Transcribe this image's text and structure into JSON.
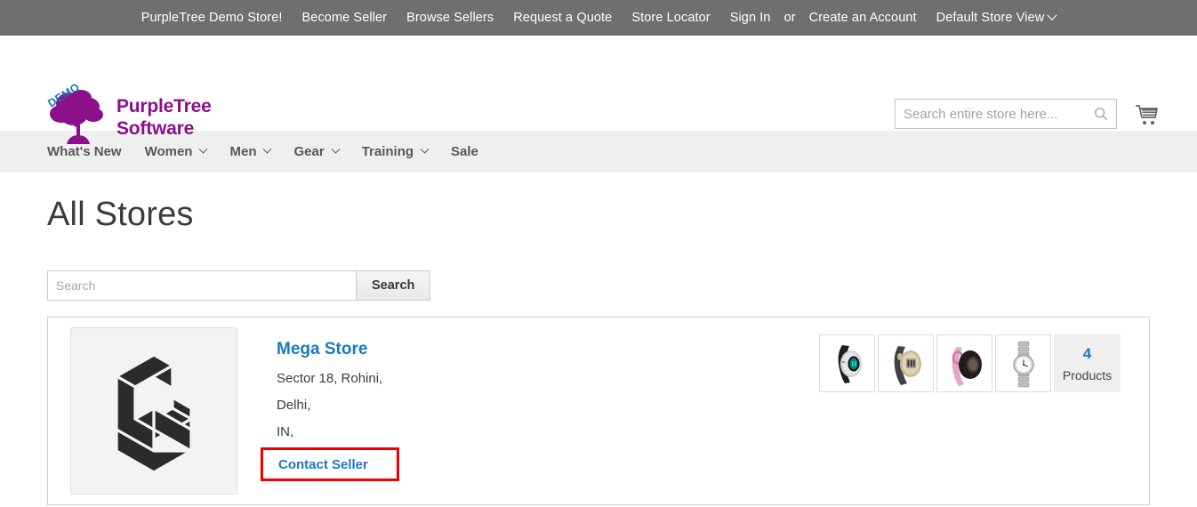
{
  "top_panel": {
    "items": [
      {
        "label": "PurpleTree Demo Store!",
        "name": "demo-store-link"
      },
      {
        "label": "Become Seller",
        "name": "become-seller-link"
      },
      {
        "label": "Browse Sellers",
        "name": "browse-sellers-link"
      },
      {
        "label": "Request a Quote",
        "name": "request-quote-link"
      },
      {
        "label": "Store Locator",
        "name": "store-locator-link"
      }
    ],
    "sign_in": "Sign In",
    "or": "or",
    "create_account": "Create an Account",
    "store_view": "Default Store View",
    "background": "#6e706e",
    "text_color": "#ffffff"
  },
  "header": {
    "logo": {
      "badge": "DEMO",
      "line1": "PurpleTree",
      "line2": "Software",
      "brand_color": "#8c0f8c",
      "badge_color": "#1f6fb5"
    },
    "search": {
      "placeholder": "Search entire store here...",
      "value": ""
    },
    "cart_label": "My Cart"
  },
  "nav": {
    "items": [
      {
        "label": "What's New",
        "has_submenu": false
      },
      {
        "label": "Women",
        "has_submenu": true
      },
      {
        "label": "Men",
        "has_submenu": true
      },
      {
        "label": "Gear",
        "has_submenu": true
      },
      {
        "label": "Training",
        "has_submenu": true
      },
      {
        "label": "Sale",
        "has_submenu": false
      }
    ],
    "background": "#efefef",
    "text_color": "#575757"
  },
  "main": {
    "page_title": "All Stores",
    "store_search": {
      "placeholder": "Search",
      "value": "",
      "button_label": "Search"
    },
    "stores": [
      {
        "name": "Mega Store",
        "name_color": "#1979c3",
        "address_lines": [
          "Sector 18, Rohini,",
          "Delhi,",
          "IN,"
        ],
        "contact_label": "Contact Seller",
        "contact_highlighted": true,
        "highlight_color": "#ee0000",
        "logo_alt": "mega-store-logo",
        "product_count": "4",
        "product_count_label": "Products",
        "thumbnails": [
          {
            "alt": "sport-watch-black-silver"
          },
          {
            "alt": "digital-watch-gray-gold"
          },
          {
            "alt": "fitness-band-pink-black"
          },
          {
            "alt": "analog-watch-silver-bracelet"
          }
        ]
      }
    ]
  }
}
